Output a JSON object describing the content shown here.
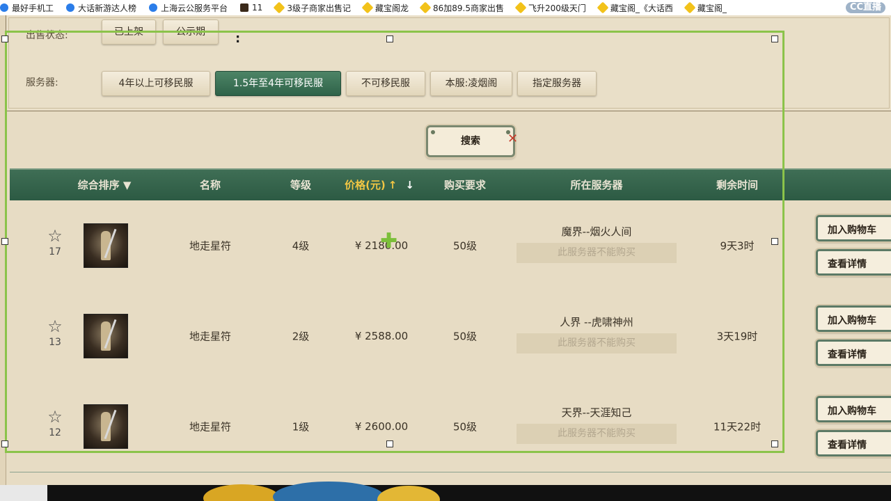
{
  "bookmarks": [
    {
      "label": "最好手机工",
      "icon": "blue"
    },
    {
      "label": "大话新游达人榜",
      "icon": "blue"
    },
    {
      "label": "上海云公服务平台",
      "icon": "blue"
    },
    {
      "label": "11",
      "icon": "dark"
    },
    {
      "label": "3级子商家出售记",
      "icon": "yellow"
    },
    {
      "label": "藏宝阁龙",
      "icon": "yellow"
    },
    {
      "label": "86加89.5商家出售",
      "icon": "yellow"
    },
    {
      "label": "飞升200级天门",
      "icon": "yellow"
    },
    {
      "label": "藏宝阁_《大话西",
      "icon": "yellow"
    },
    {
      "label": "藏宝阁_",
      "icon": "yellow"
    }
  ],
  "cc_logo": "CC直播",
  "filters": {
    "status_label": "出售状态:",
    "status_options": [
      "已上架",
      "公示期"
    ],
    "server_label": "服务器:",
    "server_options": [
      {
        "label": "4年以上可移民服",
        "active": false
      },
      {
        "label": "1.5年至4年可移民服",
        "active": true
      },
      {
        "label": "不可移民服",
        "active": false
      },
      {
        "label": "本服:凌烟阁",
        "active": false
      },
      {
        "label": "指定服务器",
        "active": false
      }
    ],
    "colon": ":"
  },
  "search": {
    "label": "搜索",
    "close": "✕"
  },
  "table": {
    "headers": {
      "sort": "综合排序",
      "sort_arrow": "▼",
      "name": "名称",
      "level": "等级",
      "price": "价格(元)",
      "price_up": "↑",
      "price_down": "↓",
      "requirement": "购买要求",
      "server": "所在服务器",
      "time_left": "剩余时间"
    },
    "rows": [
      {
        "fav_count": "17",
        "name": "地走星符",
        "level": "4级",
        "price": "¥ 2180.00",
        "requirement": "50级",
        "server": "魔界--烟火人间",
        "server_note": "此服务器不能购买",
        "time_left": "9天3时",
        "add_cart": "加入购物车",
        "details": "查看详情"
      },
      {
        "fav_count": "13",
        "name": "地走星符",
        "level": "2级",
        "price": "¥ 2588.00",
        "requirement": "50级",
        "server": "人界 --虎啸神州",
        "server_note": "此服务器不能购买",
        "time_left": "3天19时",
        "add_cart": "加入购物车",
        "details": "查看详情"
      },
      {
        "fav_count": "12",
        "name": "地走星符",
        "level": "1级",
        "price": "¥ 2600.00",
        "requirement": "50级",
        "server": "天界--天涯知己",
        "server_note": "此服务器不能购买",
        "time_left": "11天22时",
        "add_cart": "加入购物车",
        "details": "查看详情"
      }
    ]
  },
  "colors": {
    "accent_green": "#2f6349",
    "selection_green": "#8bc34a",
    "price_gold": "#f1c644",
    "background": "#e7dcc4"
  }
}
